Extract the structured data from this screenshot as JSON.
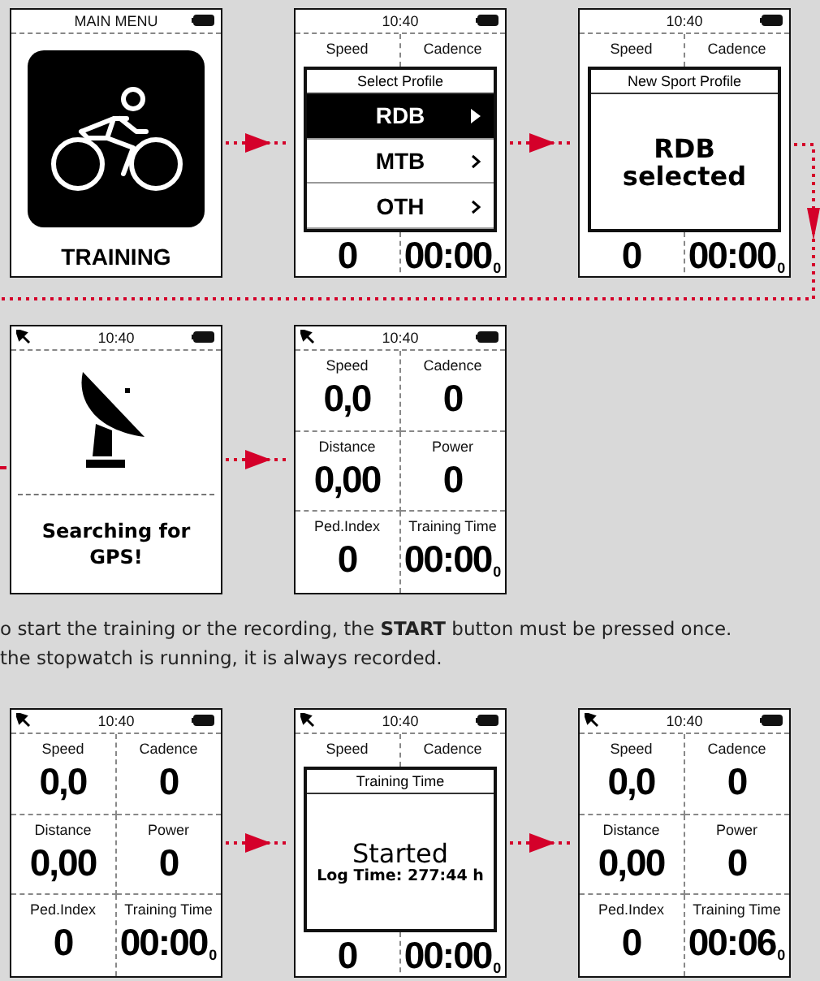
{
  "row_1": {
    "screens": [
      {
        "kind": "menu",
        "header": "MAIN MENU",
        "title": "TRAINING"
      },
      {
        "kind": "popup",
        "time": "10:40",
        "satellite": false,
        "labels": [
          "Speed",
          "Cadence"
        ],
        "values": [
          {
            "value": "0"
          },
          {
            "value": "00:00",
            "suffix": "0"
          }
        ],
        "overlay": {
          "kind": "list",
          "title": "Select Profile",
          "items": [
            {
              "label": "RDB",
              "selected": true
            },
            {
              "label": "MTB",
              "selected": false
            },
            {
              "label": "OTH",
              "selected": false
            }
          ]
        }
      },
      {
        "kind": "popup",
        "time": "10:40",
        "satellite": false,
        "labels": [
          "Speed",
          "Cadence"
        ],
        "values": [
          {
            "value": "0"
          },
          {
            "value": "00:00",
            "suffix": "0"
          }
        ],
        "overlay": {
          "kind": "message",
          "title": "New Sport Profile",
          "lines": [
            {
              "kind": "heading",
              "text": "RDB"
            },
            {
              "kind": "heading",
              "text": "selected"
            }
          ]
        }
      }
    ]
  },
  "row_2": {
    "screens": [
      {
        "kind": "gps",
        "time": "10:40",
        "satellite": true,
        "message": "Searching for GPS!"
      },
      {
        "kind": "dashboard",
        "time": "10:40",
        "satellite": true,
        "fields": [
          {
            "label": "Speed",
            "value": "0,0"
          },
          {
            "label": "Cadence",
            "value": "0"
          },
          {
            "label": "Distance",
            "value": "0,00"
          },
          {
            "label": "Power",
            "value": "0"
          },
          {
            "label": "Ped.Index",
            "value": "0"
          },
          {
            "label": "Training Time",
            "value": "00:00",
            "suffix": "0"
          }
        ]
      }
    ]
  },
  "note": {
    "lines": [
      "o start the training or the recording, the **START** button must be pressed once.",
      "the stopwatch is running, it is always recorded."
    ]
  },
  "row_3": {
    "screens": [
      {
        "kind": "dashboard",
        "time": "10:40",
        "satellite": true,
        "fields": [
          {
            "label": "Speed",
            "value": "0,0"
          },
          {
            "label": "Cadence",
            "value": "0"
          },
          {
            "label": "Distance",
            "value": "0,00"
          },
          {
            "label": "Power",
            "value": "0"
          },
          {
            "label": "Ped.Index",
            "value": "0"
          },
          {
            "label": "Training Time",
            "value": "00:00",
            "suffix": "0"
          }
        ]
      },
      {
        "kind": "popup",
        "time": "10:40",
        "satellite": true,
        "labels": [
          "Speed",
          "Cadence"
        ],
        "values": [
          {
            "value": "0"
          },
          {
            "value": "00:00",
            "suffix": "0"
          }
        ],
        "overlay": {
          "kind": "message",
          "title": "Training Time",
          "lines": [
            {
              "kind": "heading",
              "text": "Started"
            },
            {
              "kind": "detail",
              "text": "Log Time: 277:44 h"
            }
          ]
        }
      },
      {
        "kind": "dashboard",
        "time": "10:40",
        "satellite": true,
        "fields": [
          {
            "label": "Speed",
            "value": "0,0"
          },
          {
            "label": "Cadence",
            "value": "0"
          },
          {
            "label": "Distance",
            "value": "0,00"
          },
          {
            "label": "Power",
            "value": "0"
          },
          {
            "label": "Ped.Index",
            "value": "0"
          },
          {
            "label": "Training Time",
            "value": "00:06",
            "suffix": "0"
          }
        ]
      }
    ]
  }
}
